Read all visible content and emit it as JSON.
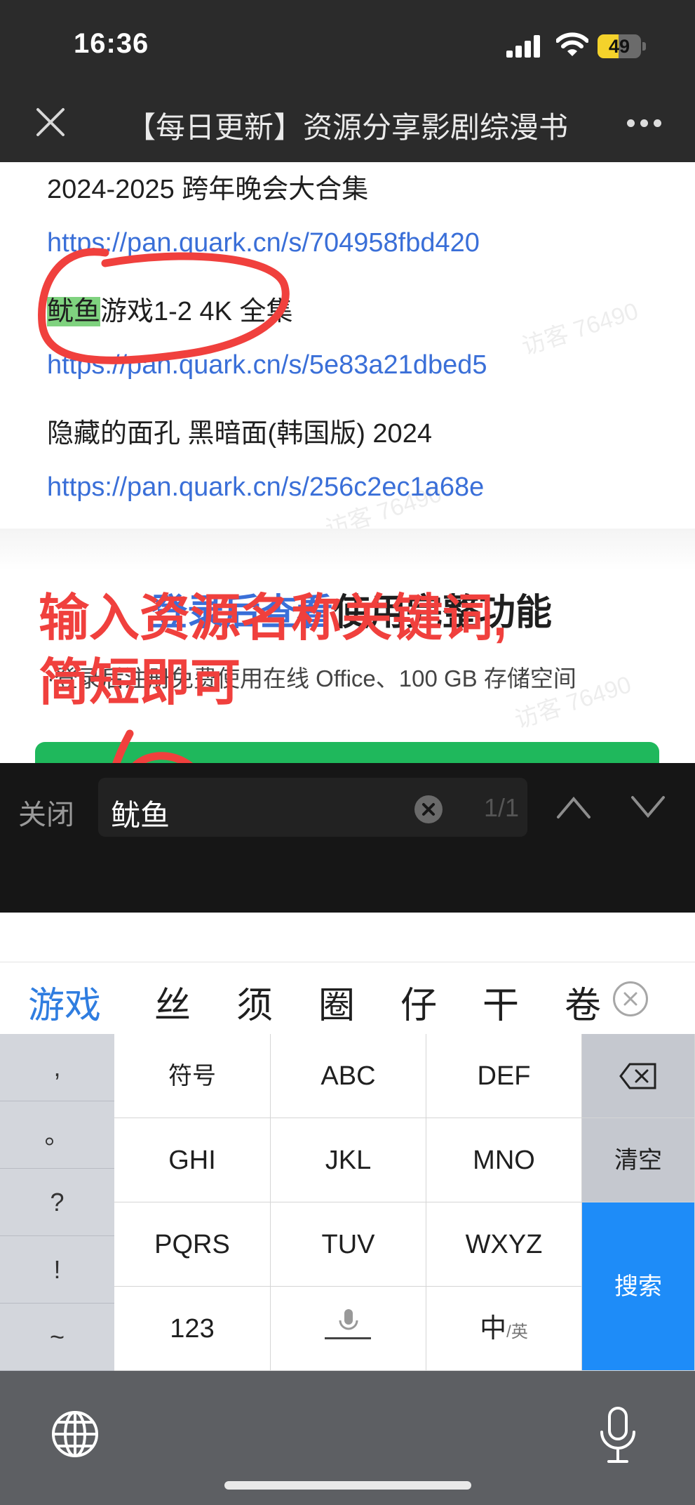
{
  "status_bar": {
    "time": "16:36",
    "battery": "49",
    "battery_fraction": 0.49
  },
  "nav": {
    "title": "【每日更新】资源分享影剧综漫书"
  },
  "article": {
    "lines": [
      "2024-2025 跨年晚会大合集",
      "https://pan.quark.cn/s/704958fbd420",
      "游戏1-2 4K 全集",
      "https://pan.quark.cn/s/5e83a21dbed5",
      "隐藏的面孔 黑暗面(韩国版) 2024",
      "https://pan.quark.cn/s/256c2ec1a68e"
    ],
    "highlight": "鱿鱼",
    "watermark": "访客 76490"
  },
  "promo": {
    "title_link": "登录后查看",
    "title_rest": "使用完整功能",
    "subtitle": "·登录后注册免费使用在线 Office、100 GB 存储空间"
  },
  "annotation": {
    "line1": "输入资源名称关键词,",
    "line2": "简短即可",
    "color": "#f0403d"
  },
  "find_bar": {
    "close": "关闭",
    "query": "鱿鱼",
    "count": "1/1"
  },
  "candidates": [
    "游戏",
    "丝",
    "须",
    "圈",
    "仔",
    "干",
    "卷"
  ],
  "keyboard": {
    "punct": [
      ",",
      "。",
      "?",
      "!",
      "~"
    ],
    "row1": [
      "符号",
      "ABC",
      "DEF"
    ],
    "row2": [
      "GHI",
      "JKL",
      "MNO"
    ],
    "row3": [
      "PQRS",
      "TUV",
      "WXYZ"
    ],
    "row4_left": "123",
    "row4_right_main": "中",
    "row4_right_sub": "/英",
    "clear": "清空",
    "search": "搜索"
  },
  "colors": {
    "accent": "#1e8cf8",
    "link": "#3a6fd8",
    "highlight": "#7fd27f"
  }
}
